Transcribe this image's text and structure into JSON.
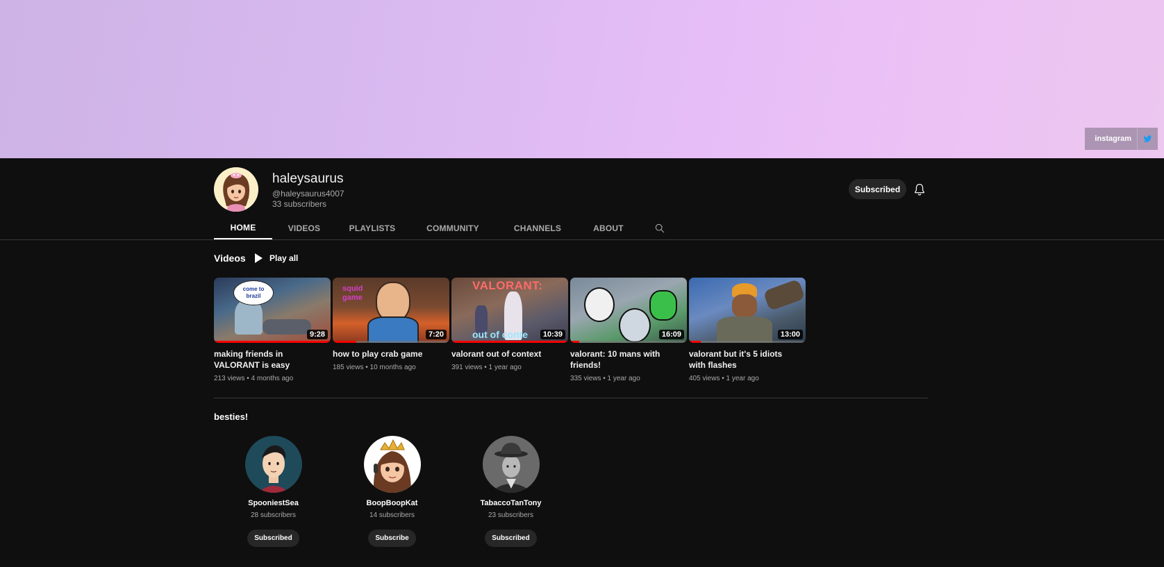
{
  "banner": {
    "links": [
      {
        "label": "instagram",
        "icon": "instagram-icon"
      },
      {
        "label": "",
        "icon": "twitter-icon"
      }
    ]
  },
  "channel": {
    "name": "haleysaurus",
    "handle": "@haleysaurus4007",
    "subscribers": "33 subscribers",
    "subscribe_label": "Subscribed"
  },
  "tabs": [
    "HOME",
    "VIDEOS",
    "PLAYLISTS",
    "COMMUNITY",
    "CHANNELS",
    "ABOUT"
  ],
  "videos_section": {
    "title": "Videos",
    "play_all": "Play all",
    "items": [
      {
        "title": "making friends in VALORANT is easy",
        "views": "213 views",
        "age": "4 months ago",
        "duration": "9:28",
        "watched": 1.0,
        "thumb_text": "come to brazil"
      },
      {
        "title": "how to play crab game",
        "views": "185 views",
        "age": "10 months ago",
        "duration": "7:20",
        "watched": 0.2,
        "thumb_text": "squid game"
      },
      {
        "title": "valorant out of context",
        "views": "391 views",
        "age": "1 year ago",
        "duration": "10:39",
        "watched": 1.0,
        "thumb_text": "VALORANT:",
        "thumb_text2": "out of conte"
      },
      {
        "title": "valorant: 10 mans with friends!",
        "views": "335 views",
        "age": "1 year ago",
        "duration": "16:09",
        "watched": 0.08,
        "thumb_text": ""
      },
      {
        "title": "valorant but it's 5 idiots with flashes",
        "views": "405 views",
        "age": "1 year ago",
        "duration": "13:00",
        "watched": 0.1,
        "thumb_text": ""
      }
    ]
  },
  "besties": {
    "title": "besties!",
    "items": [
      {
        "name": "SpooniestSea",
        "subscribers": "28 subscribers",
        "button": "Subscribed"
      },
      {
        "name": "BoopBoopKat",
        "subscribers": "14 subscribers",
        "button": "Subscribe"
      },
      {
        "name": "TabaccoTanTony",
        "subscribers": "23 subscribers",
        "button": "Subscribed"
      }
    ]
  },
  "colors": {
    "background": "#0f0f0f",
    "progress": "#ff0000",
    "button_bg": "#272727"
  }
}
